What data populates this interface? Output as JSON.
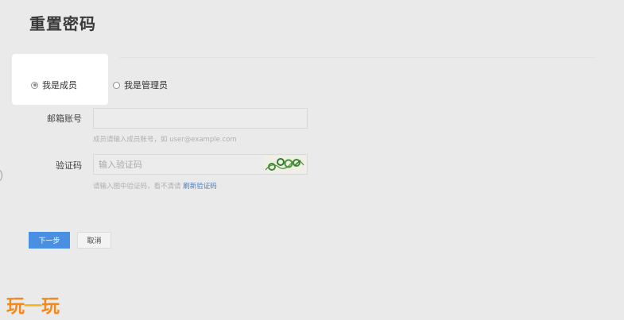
{
  "page": {
    "title": "重置密码"
  },
  "role_selector": {
    "options": [
      {
        "label": "我是成员",
        "selected": true
      },
      {
        "label": "我是管理员",
        "selected": false
      }
    ]
  },
  "form": {
    "email": {
      "label": "邮箱账号",
      "value": "",
      "placeholder": "",
      "hint": "成员请输入成员账号，如 user@example.com"
    },
    "captcha": {
      "label": "验证码",
      "value": "",
      "placeholder": "输入验证码",
      "hint_text": "请输入图中验证码，看不清请 ",
      "refresh_label": "刷新验证码"
    }
  },
  "actions": {
    "next_label": "下一步",
    "cancel_label": "取消"
  },
  "watermark": {
    "text_1": "玩",
    "text_2": "一",
    "text_3": "玩"
  },
  "colors": {
    "primary": "#4a90e2",
    "link": "#4a7fc1",
    "background": "#eaeaea",
    "watermark_orange": "#f28a1b",
    "watermark_yellow": "#f5b320"
  }
}
